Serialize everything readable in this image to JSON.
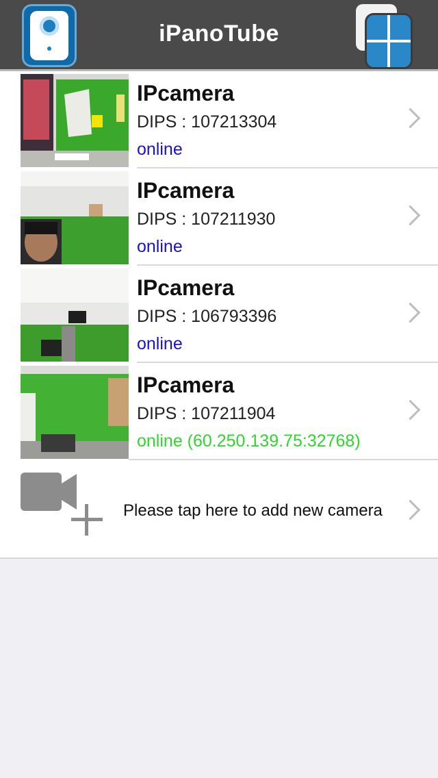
{
  "header": {
    "title": "iPanoTube",
    "app_icon": "camera-app-icon",
    "right_button_icon": "grid-view-icon"
  },
  "cameras": [
    {
      "name": "IPcamera",
      "id": "DIPS : 107213304",
      "status": "online",
      "status_color": "#1a12c8"
    },
    {
      "name": "IPcamera",
      "id": "DIPS : 107211930",
      "status": "online",
      "status_color": "#1a12c8"
    },
    {
      "name": "IPcamera",
      "id": "DIPS : 106793396",
      "status": "online",
      "status_color": "#1a12c8"
    },
    {
      "name": "IPcamera",
      "id": "DIPS : 107211904",
      "status": "online (60.250.139.75:32768)",
      "status_color": "#2fd62f"
    }
  ],
  "add_camera": {
    "label": "Please tap here to add new camera",
    "icon": "add-camera-icon"
  },
  "colors": {
    "navbar": "#4a4a4a",
    "accent_blue": "#1e7fc0",
    "background": "#efeff4"
  }
}
